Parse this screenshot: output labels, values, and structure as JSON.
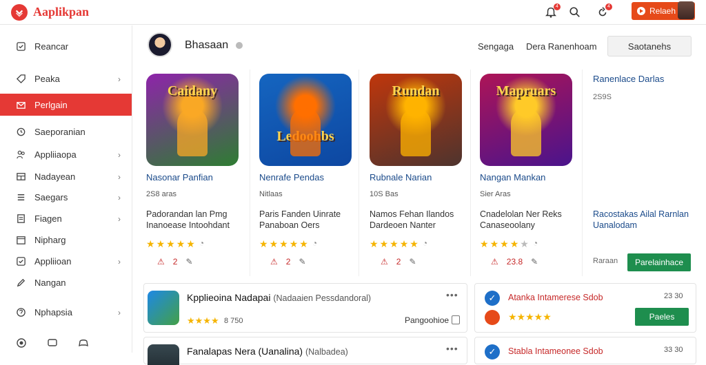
{
  "app": {
    "title": "Aaplikpan",
    "top_button": "Relaeh",
    "badge1": "4",
    "badge2": "4"
  },
  "sidebar": {
    "items": [
      {
        "label": "Reancar",
        "icon": "checkbox-icon",
        "chevron": false
      },
      {
        "label": "Peaka",
        "icon": "tag-icon",
        "chevron": true
      },
      {
        "label": "Perlgain",
        "icon": "mail-icon",
        "chevron": false
      },
      {
        "label": "Saeporanian",
        "icon": "history-icon",
        "chevron": false
      },
      {
        "label": "Appliiaopa",
        "icon": "people-icon",
        "chevron": true
      },
      {
        "label": "Nadayean",
        "icon": "grid-icon",
        "chevron": true
      },
      {
        "label": "Saegars",
        "icon": "list-icon",
        "chevron": true
      },
      {
        "label": "Fiagen",
        "icon": "document-icon",
        "chevron": true
      },
      {
        "label": "Nipharg",
        "icon": "calendar-icon",
        "chevron": false
      },
      {
        "label": "Appliioan",
        "icon": "checkbox-icon",
        "chevron": true
      },
      {
        "label": "Nangan",
        "icon": "pen-icon",
        "chevron": false
      },
      {
        "label": "Nphapsia",
        "icon": "help-icon",
        "chevron": true
      }
    ]
  },
  "header": {
    "title": "Bhasaan",
    "link1": "Sengaga",
    "link2": "Dera Ranenhoam",
    "button": "Saotanehs"
  },
  "cards": [
    {
      "art": "Caidany",
      "name": "Nasonar Panfian",
      "meta": "2S8 aras",
      "desc": "Padorandan lan Pmg Inanoease Intoohdant",
      "rating": 5,
      "stat1": "2",
      "stat_icon": "pen-icon"
    },
    {
      "art": "Ledoohbs",
      "name": "Nenrafe Pendas",
      "meta": "Nitlaas",
      "desc": "Paris Fanden Uinrate Panaboan Oers",
      "rating": 5,
      "stat1": "2",
      "stat_icon": "pen-icon"
    },
    {
      "art": "Rundan",
      "name": "Rubnale Narian",
      "meta": "10S Bas",
      "desc": "Namos Fehan Ilandos Dardeoen Nanter",
      "rating": 5,
      "stat1": "2",
      "stat_icon": "refresh-icon"
    },
    {
      "art": "Mapruars",
      "name": "Nangan Mankan",
      "meta": "Sier Aras",
      "desc": "Cnadelolan Ner Reks Canaseoolany",
      "rating": 4,
      "stat1": "23.8",
      "stat_icon": "badge-icon"
    }
  ],
  "ad": {
    "title": "Ranenlace Darlas",
    "sub": "2S9S",
    "desc": "Racostakas Ailal Rarnlan Uanalodam",
    "note": "Raraan",
    "button": "Parelainhace"
  },
  "list1": {
    "title": "Kpplieoina Nadapai",
    "sub": "(Nadaaien Pessdandoral)",
    "rating": "8 750",
    "action": "Pangoohioe"
  },
  "list2": {
    "title": "Fanalapas Nera (Uanalina)",
    "sub": "(Nalbadea)"
  },
  "right1": {
    "title": "Atanka Intamerese Sdob",
    "count": "23 30",
    "button": "Paeles"
  },
  "right2": {
    "title": "Stabla Intameonee Sdob",
    "count": "33 30"
  },
  "colors": {
    "accent": "#e53935",
    "green": "#1e8e4e",
    "link": "#1a4a8a"
  }
}
